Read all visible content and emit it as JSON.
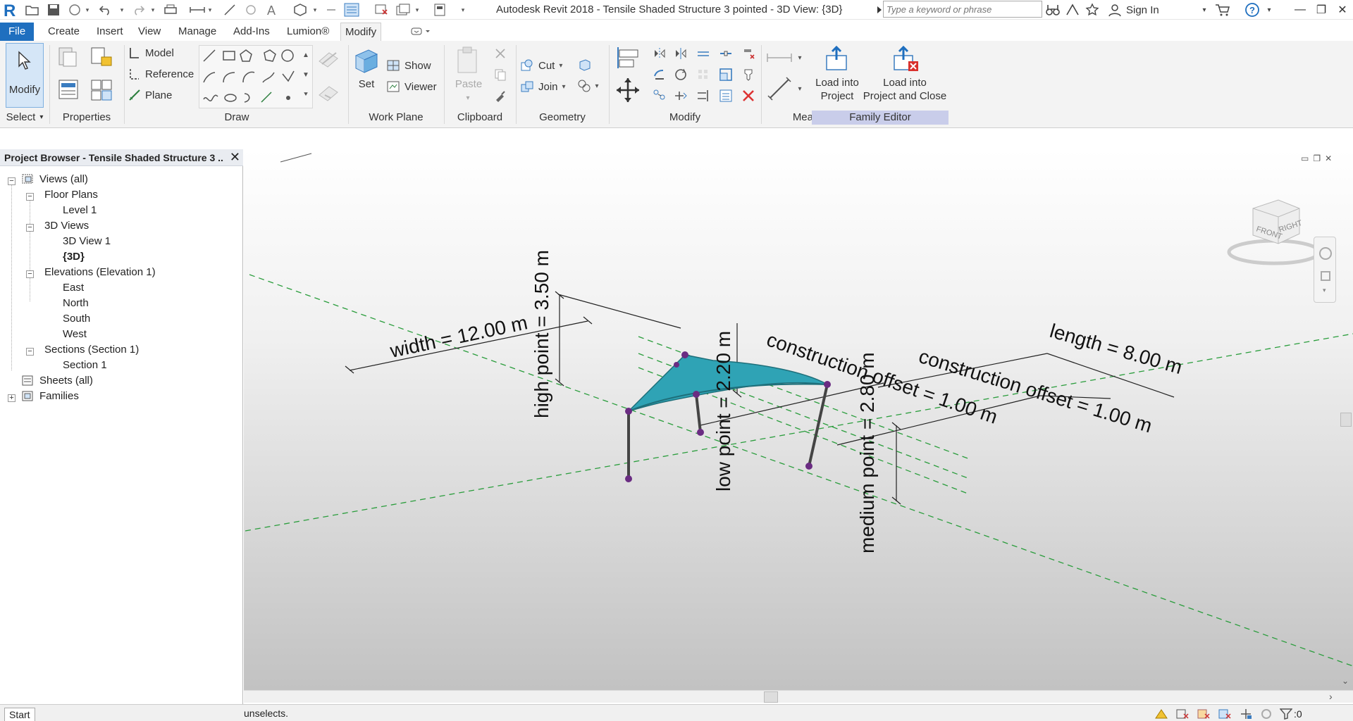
{
  "titlebar": {
    "app_title": "Autodesk Revit 2018 -    Tensile Shaded Structure 3 pointed - 3D View: {3D}",
    "search_placeholder": "Type a keyword or phrase",
    "sign_in": "Sign In"
  },
  "tabs": [
    {
      "label": "File"
    },
    {
      "label": "Create"
    },
    {
      "label": "Insert"
    },
    {
      "label": "View"
    },
    {
      "label": "Manage"
    },
    {
      "label": "Add-Ins"
    },
    {
      "label": "Lumion®"
    },
    {
      "label": "Modify"
    }
  ],
  "ribbon": {
    "select": {
      "modify_label": "Modify",
      "title": "Select"
    },
    "properties": {
      "title": "Properties"
    },
    "draw": {
      "model": "Model",
      "reference": "Reference",
      "plane": "Plane",
      "title": "Draw"
    },
    "work_plane": {
      "set": "Set",
      "show": "Show",
      "viewer": "Viewer",
      "title": "Work Plane"
    },
    "clipboard": {
      "paste": "Paste",
      "title": "Clipboard"
    },
    "geometry": {
      "cut": "Cut",
      "join": "Join",
      "title": "Geometry"
    },
    "modify": {
      "title": "Modify"
    },
    "measure": {
      "title": "Measure"
    },
    "family_editor": {
      "load_into_project_line1": "Load into",
      "load_into_project_line2": "Project",
      "load_close_line1": "Load into",
      "load_close_line2": "Project and Close",
      "title": "Family Editor"
    }
  },
  "browser": {
    "title": "Project Browser - Tensile Shaded Structure 3 ...",
    "tree": {
      "views_all": "Views (all)",
      "floor_plans": "Floor Plans",
      "level_1": "Level 1",
      "views_3d": "3D Views",
      "view_3d_1": "3D View 1",
      "view_3d_default": "{3D}",
      "elevations": "Elevations (Elevation 1)",
      "east": "East",
      "north": "North",
      "south": "South",
      "west": "West",
      "sections": "Sections (Section 1)",
      "section_1": "Section 1",
      "sheets": "Sheets (all)",
      "families": "Families"
    }
  },
  "viewport": {
    "dimensions": {
      "width": "width = 12.00 m",
      "high_point": "high point = 3.50 m",
      "low_point": "low point = 2.20 m",
      "medium_point": "medium point = 2.80 m",
      "construction_offset_1": "construction offset = 1.00 m",
      "construction_offset_2": "construction offset = 1.00 m",
      "length": "length = 8.00 m"
    },
    "viewcube": {
      "front": "FRONT",
      "right": "RIGHT"
    },
    "canopy_color": "#2fa3b5"
  },
  "status": {
    "text": "unselects.",
    "start_tab": "Start",
    "filter_count": ":0"
  }
}
